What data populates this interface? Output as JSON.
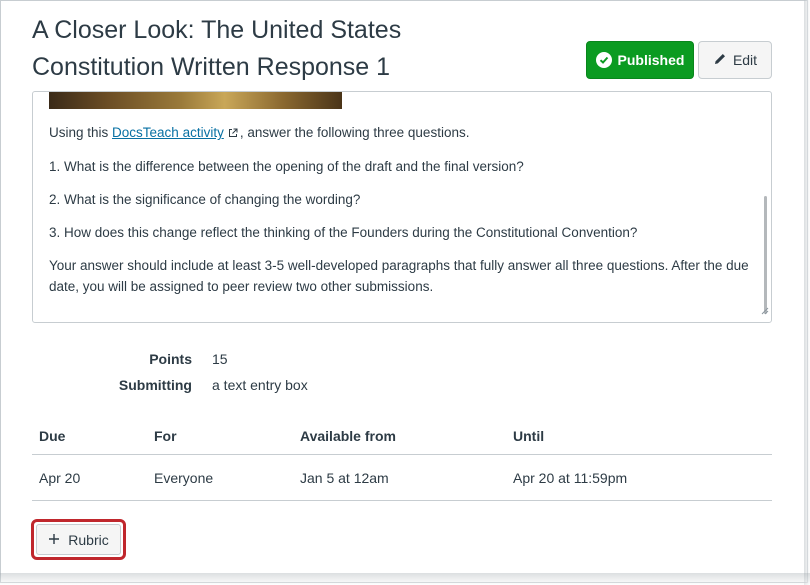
{
  "assignment": {
    "title_line1": "A Closer Look: The United States",
    "title_line2": "Constitution Written Response 1"
  },
  "header_buttons": {
    "published_label": "Published",
    "edit_label": "Edit",
    "published_color": "#0b9b21"
  },
  "description": {
    "intro_prefix": "Using this ",
    "link_text": "DocsTeach activity",
    "intro_suffix": ", answer the following three questions.",
    "question1": "1. What is the difference between the opening of the draft and the final version?",
    "question2": "2. What is the significance of changing the wording?",
    "question3": "3. How does this change reflect the thinking of the Founders during the Constitutional Convention?",
    "instructions": "Your answer should include at least 3-5 well-developed paragraphs that fully answer all three questions. After the due date, you will be assigned to peer review two other submissions."
  },
  "details": {
    "points_label": "Points",
    "points_value": "15",
    "submitting_label": "Submitting",
    "submitting_value": "a text entry box"
  },
  "due_table": {
    "headers": [
      "Due",
      "For",
      "Available from",
      "Until"
    ],
    "rows": [
      [
        "Apr 20",
        "Everyone",
        "Jan 5 at 12am",
        "Apr 20 at 11:59pm"
      ]
    ]
  },
  "rubric_button": {
    "label": "Rubric",
    "highlight_color": "#c0272d"
  },
  "icons": [
    "check-circle-icon",
    "pencil-icon",
    "external-link-icon",
    "plus-icon",
    "resize-grip-icon"
  ]
}
